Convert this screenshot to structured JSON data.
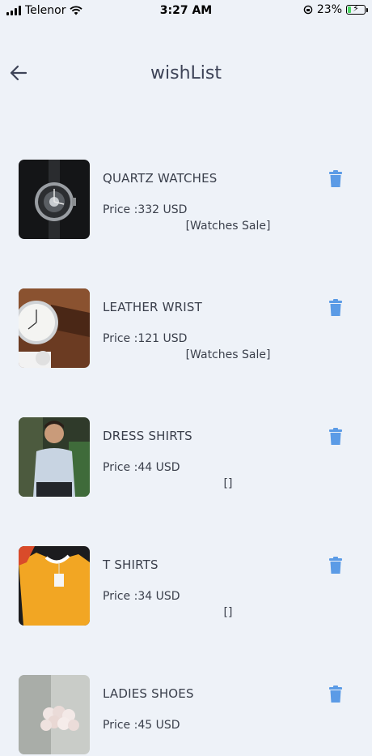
{
  "status_bar": {
    "carrier": "Telenor",
    "time": "3:27 AM",
    "battery": "23%",
    "battery_level": 0.23
  },
  "header": {
    "title": "wishList"
  },
  "items": [
    {
      "name": "QUARTZ WATCHES",
      "price": "Price :332 USD",
      "tag": "[Watches Sale]"
    },
    {
      "name": "LEATHER WRIST",
      "price": "Price :121 USD",
      "tag": "[Watches Sale]"
    },
    {
      "name": "DRESS SHIRTS",
      "price": "Price :44 USD",
      "tag": "[]"
    },
    {
      "name": "T SHIRTS",
      "price": "Price :34 USD",
      "tag": "[]"
    },
    {
      "name": "LADIES SHOES",
      "price": "Price :45 USD",
      "tag": ""
    }
  ],
  "colors": {
    "background": "#eef2f8",
    "trash": "#5b9be6"
  }
}
